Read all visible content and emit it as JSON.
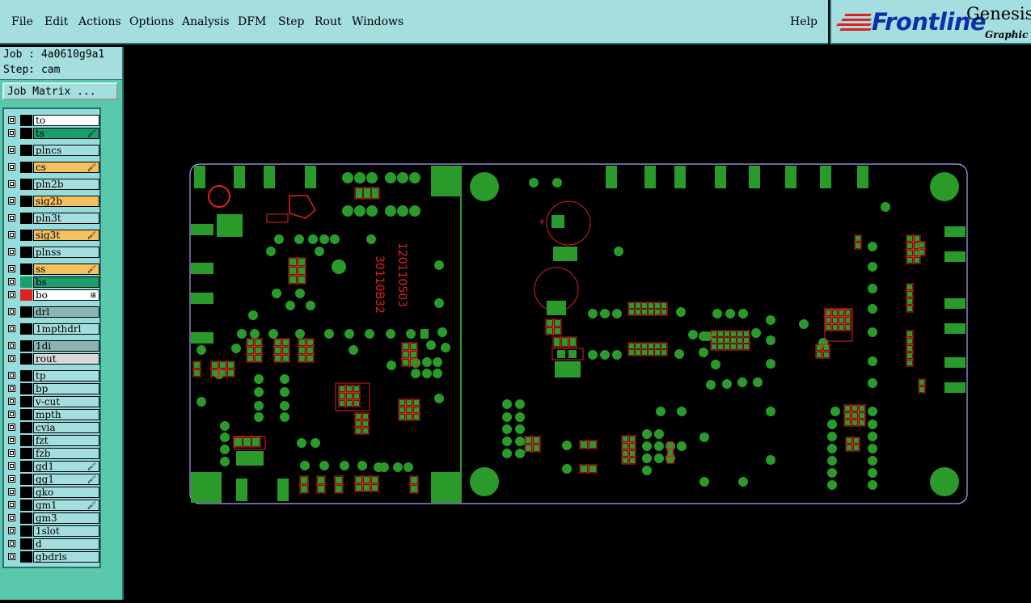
{
  "menu": {
    "file": "File",
    "edit": "Edit",
    "actions": "Actions",
    "options": "Options",
    "analysis": "Analysis",
    "dfm": "DFM",
    "step": "Step",
    "rout": "Rout",
    "windows": "Windows",
    "help": "Help"
  },
  "logo": {
    "brand": "Frontline",
    "product": "Genesis",
    "tagline": "Graphic E"
  },
  "job": {
    "job_line": "Job : 4a0610g9a1",
    "step_line": "Step: cam",
    "matrix_button": "Job Matrix ..."
  },
  "layers": [
    {
      "name": "to",
      "color": "#ffffff",
      "swatch": "#000000",
      "mark": ""
    },
    {
      "name": "ts",
      "color": "#1a9e6e",
      "swatch": "#000000",
      "mark": "🖌"
    },
    {
      "name": "plncs",
      "color": "#a5dede",
      "swatch": "#000000",
      "mark": ""
    },
    {
      "name": "cs",
      "color": "#f5c060",
      "swatch": "#000000",
      "mark": "🖌"
    },
    {
      "name": "pln2b",
      "color": "#a5dede",
      "swatch": "#000000",
      "mark": ""
    },
    {
      "name": "sig2b",
      "color": "#f5c060",
      "swatch": "#000000",
      "mark": ""
    },
    {
      "name": "pln3t",
      "color": "#a5dede",
      "swatch": "#000000",
      "mark": ""
    },
    {
      "name": "sig3t",
      "color": "#f5c060",
      "swatch": "#000000",
      "mark": "🖌"
    },
    {
      "name": "plnss",
      "color": "#a5dede",
      "swatch": "#000000",
      "mark": ""
    },
    {
      "name": "ss",
      "color": "#f5c060",
      "swatch": "#000000",
      "mark": "🖌"
    },
    {
      "name": "bs",
      "color": "#1a9e6e",
      "swatch": "#1a9e6e",
      "mark": ""
    },
    {
      "name": "bo",
      "color": "#ffffff",
      "swatch": "#e02020",
      "mark": "⊞"
    },
    {
      "name": "drl",
      "color": "#8cb4b4",
      "swatch": "#000000",
      "mark": ""
    },
    {
      "name": "1mpthdrl",
      "color": "#a5dede",
      "swatch": "#000000",
      "mark": ""
    },
    {
      "name": "1di",
      "color": "#8cb4b4",
      "swatch": "#000000",
      "mark": ""
    },
    {
      "name": "rout",
      "color": "#d8d8d8",
      "swatch": "#000000",
      "mark": ""
    },
    {
      "name": "tp",
      "color": "#a5dede",
      "swatch": "#000000",
      "mark": ""
    },
    {
      "name": "bp",
      "color": "#a5dede",
      "swatch": "#000000",
      "mark": ""
    },
    {
      "name": "v-cut",
      "color": "#a5dede",
      "swatch": "#000000",
      "mark": ""
    },
    {
      "name": "mpth",
      "color": "#a5dede",
      "swatch": "#000000",
      "mark": ""
    },
    {
      "name": "cvia",
      "color": "#a5dede",
      "swatch": "#000000",
      "mark": ""
    },
    {
      "name": "fzt",
      "color": "#a5dede",
      "swatch": "#000000",
      "mark": ""
    },
    {
      "name": "fzb",
      "color": "#a5dede",
      "swatch": "#000000",
      "mark": ""
    },
    {
      "name": "gd1",
      "color": "#a5dede",
      "swatch": "#000000",
      "mark": "🖌"
    },
    {
      "name": "gg1",
      "color": "#a5dede",
      "swatch": "#000000",
      "mark": "🖌"
    },
    {
      "name": "gko",
      "color": "#a5dede",
      "swatch": "#000000",
      "mark": ""
    },
    {
      "name": "gm1",
      "color": "#a5dede",
      "swatch": "#000000",
      "mark": "🖌"
    },
    {
      "name": "gm3",
      "color": "#a5dede",
      "swatch": "#000000",
      "mark": ""
    },
    {
      "name": "1slot",
      "color": "#a5dede",
      "swatch": "#000000",
      "mark": ""
    },
    {
      "name": "d",
      "color": "#a5dede",
      "swatch": "#000000",
      "mark": ""
    },
    {
      "name": "gbdrls",
      "color": "#a5dede",
      "swatch": "#000000",
      "mark": ""
    }
  ],
  "board": {
    "silk_text_left": "30110B32",
    "silk_text_right": "120110503",
    "colors": {
      "board_outline": "#b0a0ff",
      "pad": "#2a9a2a",
      "silk": "#e02020",
      "background": "#000000"
    }
  }
}
